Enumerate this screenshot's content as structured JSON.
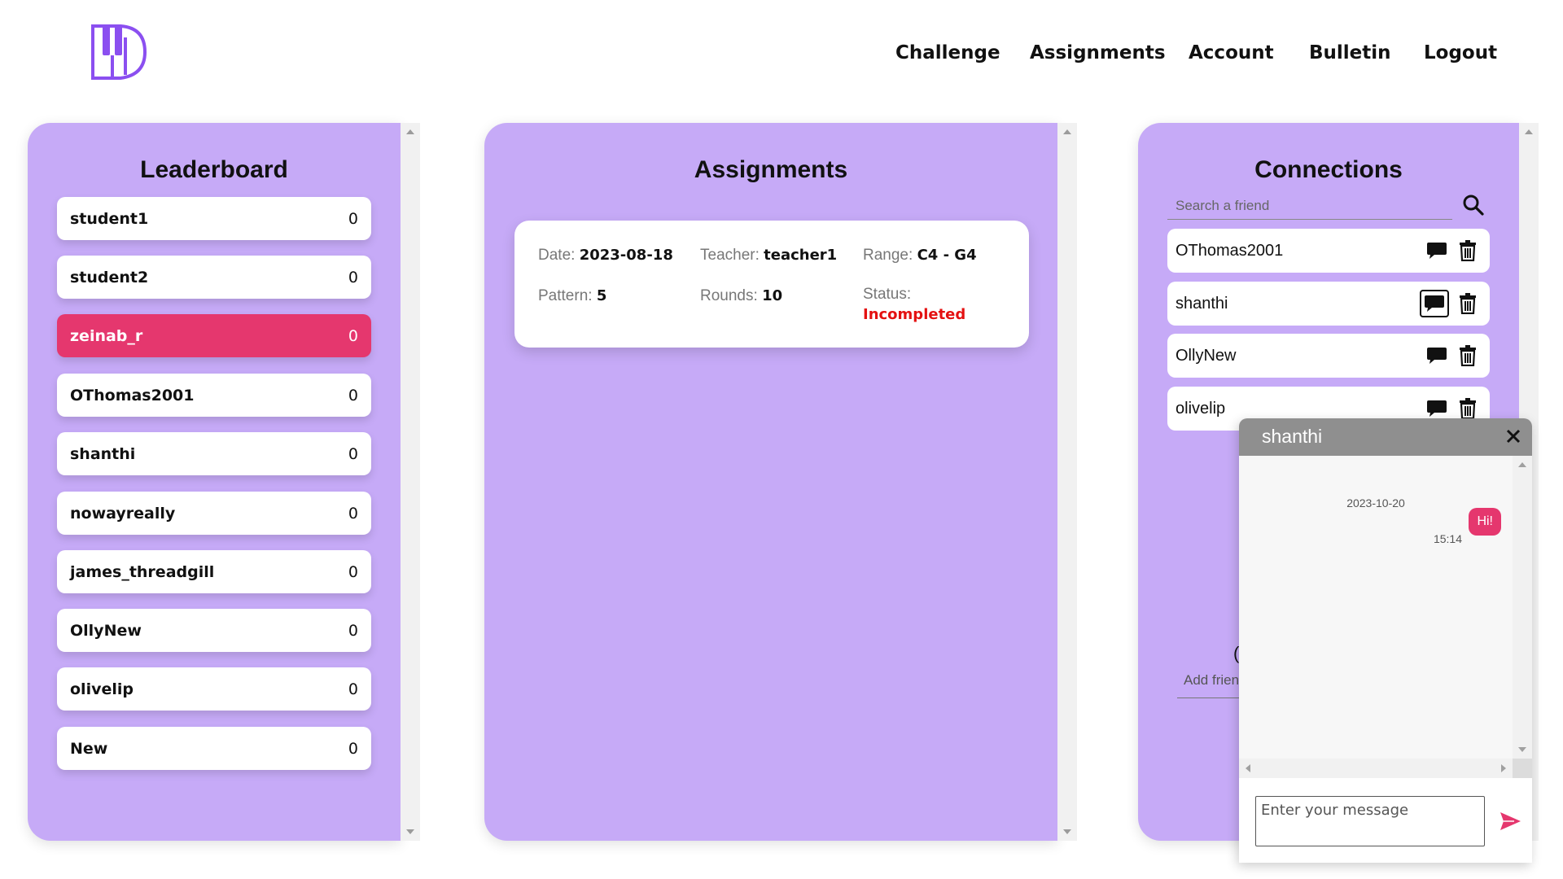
{
  "nav": {
    "challenge": "Challenge",
    "assignments": "Assignments",
    "account": "Account",
    "bulletin": "Bulletin",
    "logout": "Logout"
  },
  "leaderboard": {
    "title": "Leaderboard",
    "rows": [
      {
        "name": "student1",
        "score": "0"
      },
      {
        "name": "student2",
        "score": "0"
      },
      {
        "name": "zeinab_r",
        "score": "0",
        "active": true
      },
      {
        "name": "OThomas2001",
        "score": "0"
      },
      {
        "name": "shanthi",
        "score": "0"
      },
      {
        "name": "nowayreally",
        "score": "0"
      },
      {
        "name": "james_threadgill",
        "score": "0"
      },
      {
        "name": "OllyNew",
        "score": "0"
      },
      {
        "name": "olivelip",
        "score": "0"
      },
      {
        "name": "New",
        "score": "0"
      }
    ]
  },
  "assignments": {
    "title": "Assignments",
    "card": {
      "date_label": "Date:",
      "date": "2023-08-18",
      "teacher_label": "Teacher:",
      "teacher": "teacher1",
      "range_label": "Range:",
      "range": "C4 - G4",
      "pattern_label": "Pattern:",
      "pattern": "5",
      "rounds_label": "Rounds:",
      "rounds": "10",
      "status_label": "Status:",
      "status": "Incompleted"
    }
  },
  "connections": {
    "title": "Connections",
    "search_placeholder": "Search a friend",
    "items": [
      {
        "name": "OThomas2001"
      },
      {
        "name": "shanthi"
      },
      {
        "name": "OllyNew"
      },
      {
        "name": "olivelip"
      }
    ],
    "add_friend_partial": "Add frien",
    "partial_char": "("
  },
  "chat": {
    "name": "shanthi",
    "date": "2023-10-20",
    "message": "Hi!",
    "time": "15:14",
    "input_placeholder": "Enter your message"
  },
  "colors": {
    "panel": "#c6aaf7",
    "accent": "#e5376e",
    "logo": "#8b4ff0",
    "status_incomplete": "#e41111"
  },
  "icons": [
    "logo-icon",
    "search-icon",
    "chat-bubble-icon",
    "trash-icon",
    "close-icon",
    "send-icon"
  ]
}
